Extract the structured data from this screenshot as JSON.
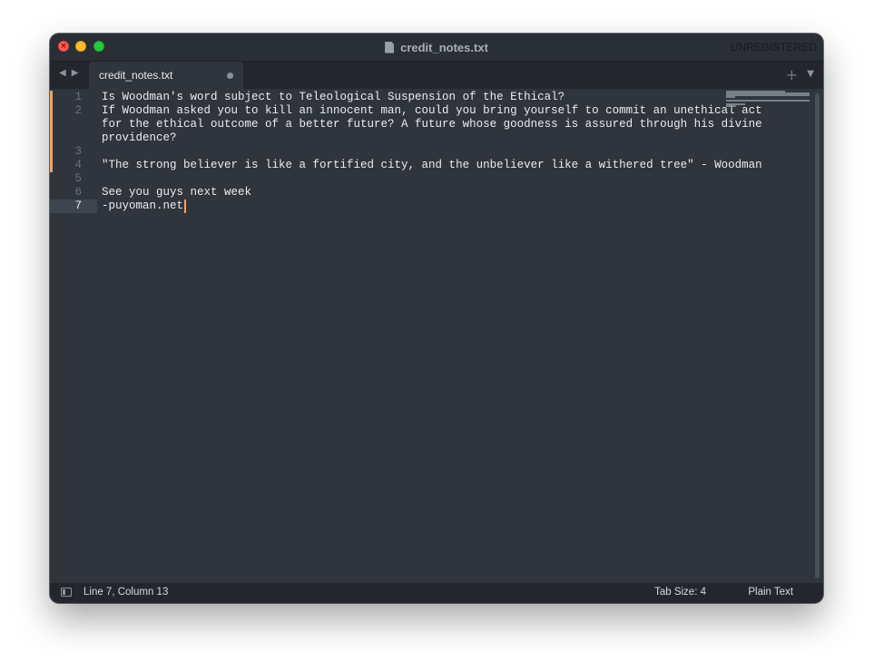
{
  "window": {
    "title": "credit_notes.txt",
    "registration": "UNREGISTERED"
  },
  "titlebar": {
    "close_glyph": "×",
    "file_icon": "document-icon"
  },
  "tabbar": {
    "back_glyph": "◀",
    "forward_glyph": "▶",
    "new_tab_glyph": "+",
    "menu_glyph": "▼",
    "tabs": [
      {
        "label": "credit_notes.txt",
        "dirty": true
      }
    ]
  },
  "editor": {
    "current_line": 7,
    "modified_lines": [
      1,
      2,
      3,
      4
    ],
    "lines": [
      {
        "number": "1",
        "rows": [
          "Is Woodman's word subject to Teleological Suspension of the Ethical?"
        ]
      },
      {
        "number": "2",
        "rows": [
          "If Woodman asked you to kill an innocent man, could you bring yourself to commit an unethical act",
          "for the ethical outcome of a better future? A future whose goodness is assured through his divine",
          "providence?"
        ]
      },
      {
        "number": "3",
        "rows": [
          ""
        ]
      },
      {
        "number": "4",
        "rows": [
          "\"The strong believer is like a fortified city, and the unbeliever like a withered tree\" - Woodman"
        ]
      },
      {
        "number": "5",
        "rows": [
          ""
        ]
      },
      {
        "number": "6",
        "rows": [
          "See you guys next week"
        ]
      },
      {
        "number": "7",
        "rows": [
          "-puyoman.net"
        ]
      }
    ]
  },
  "statusbar": {
    "position": "Line 7, Column 13",
    "tab_size": "Tab Size: 4",
    "syntax": "Plain Text",
    "sidebar_icon": "sidebar-toggle-icon"
  },
  "colors": {
    "editor_bg": "#2f343d",
    "gutter_modified": "#f3a15c",
    "cursor": "#f6a24a",
    "text": "#eaedf0"
  }
}
